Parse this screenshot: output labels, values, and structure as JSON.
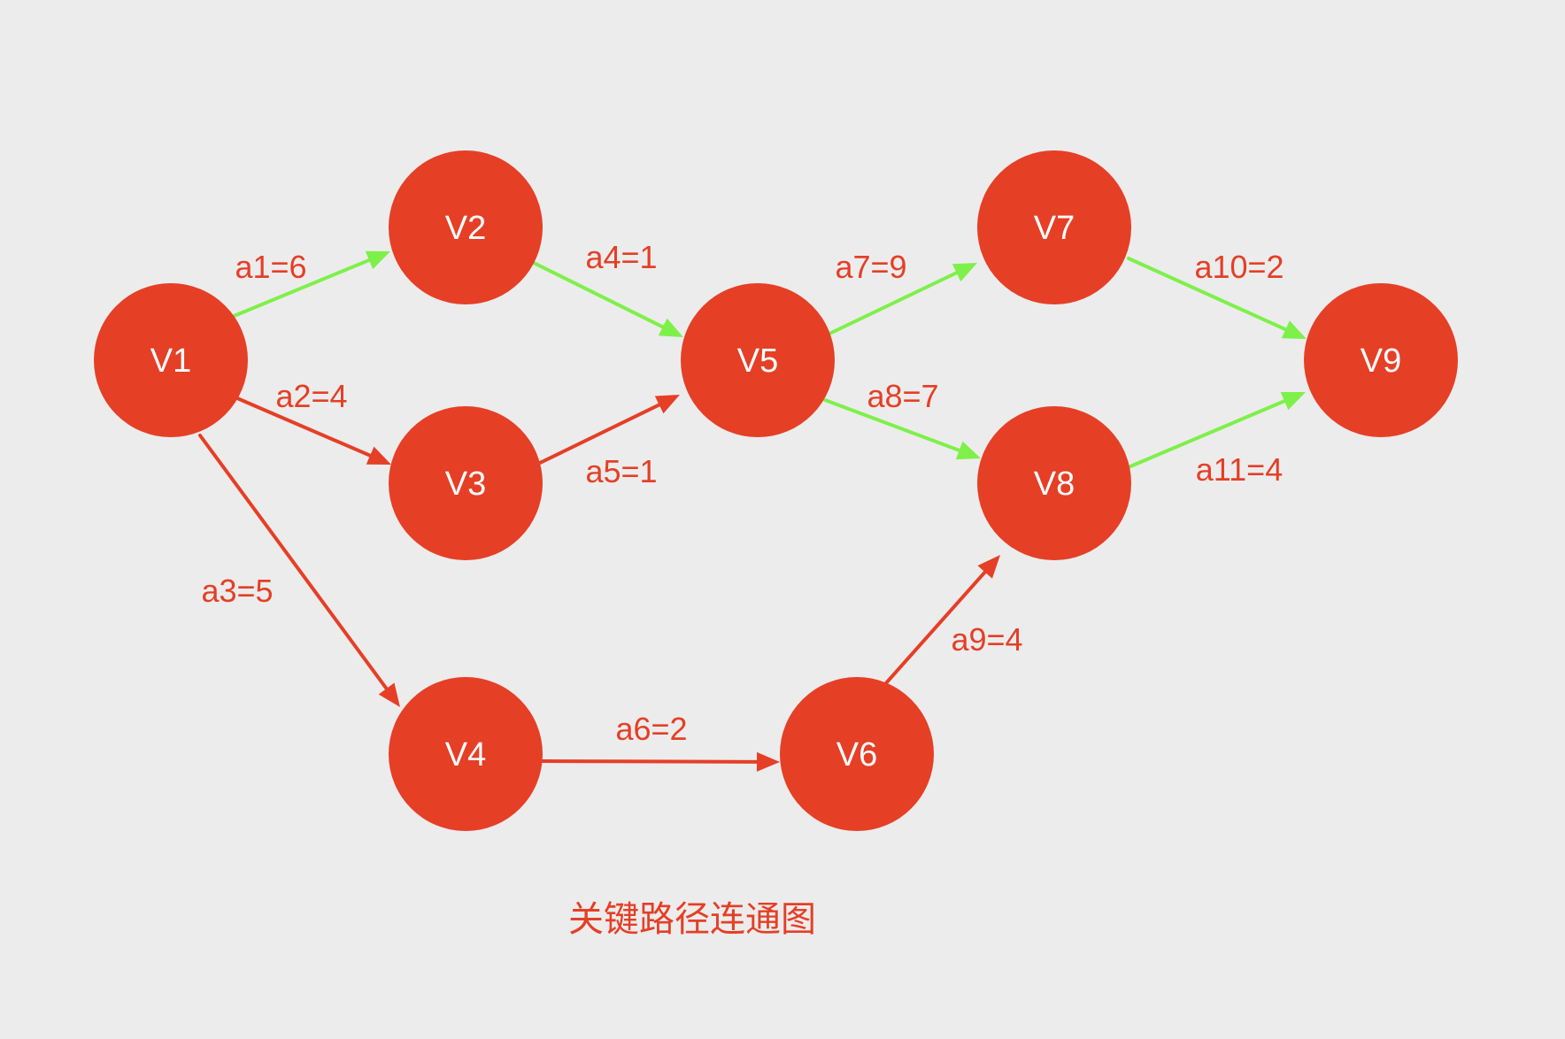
{
  "diagram": {
    "caption": "关键路径连通图",
    "colors": {
      "background": "#ececec",
      "node_fill": "#e53f26",
      "node_text": "#ffffff",
      "critical_edge": "#7ef04a",
      "normal_edge": "#e53f26",
      "label_text": "#e53f26"
    },
    "nodes": [
      {
        "id": "V1",
        "label": "V1"
      },
      {
        "id": "V2",
        "label": "V2"
      },
      {
        "id": "V3",
        "label": "V3"
      },
      {
        "id": "V4",
        "label": "V4"
      },
      {
        "id": "V5",
        "label": "V5"
      },
      {
        "id": "V6",
        "label": "V6"
      },
      {
        "id": "V7",
        "label": "V7"
      },
      {
        "id": "V8",
        "label": "V8"
      },
      {
        "id": "V9",
        "label": "V9"
      }
    ],
    "edges": [
      {
        "id": "a1",
        "from": "V1",
        "to": "V2",
        "label": "a1=6",
        "critical": true
      },
      {
        "id": "a2",
        "from": "V1",
        "to": "V3",
        "label": "a2=4",
        "critical": false
      },
      {
        "id": "a3",
        "from": "V1",
        "to": "V4",
        "label": "a3=5",
        "critical": false
      },
      {
        "id": "a4",
        "from": "V2",
        "to": "V5",
        "label": "a4=1",
        "critical": true
      },
      {
        "id": "a5",
        "from": "V3",
        "to": "V5",
        "label": "a5=1",
        "critical": false
      },
      {
        "id": "a6",
        "from": "V4",
        "to": "V6",
        "label": "a6=2",
        "critical": false
      },
      {
        "id": "a7",
        "from": "V5",
        "to": "V7",
        "label": "a7=9",
        "critical": true
      },
      {
        "id": "a8",
        "from": "V5",
        "to": "V8",
        "label": "a8=7",
        "critical": true
      },
      {
        "id": "a9",
        "from": "V6",
        "to": "V8",
        "label": "a9=4",
        "critical": false
      },
      {
        "id": "a10",
        "from": "V7",
        "to": "V9",
        "label": "a10=2",
        "critical": true
      },
      {
        "id": "a11",
        "from": "V8",
        "to": "V9",
        "label": "a11=4",
        "critical": true
      }
    ]
  }
}
